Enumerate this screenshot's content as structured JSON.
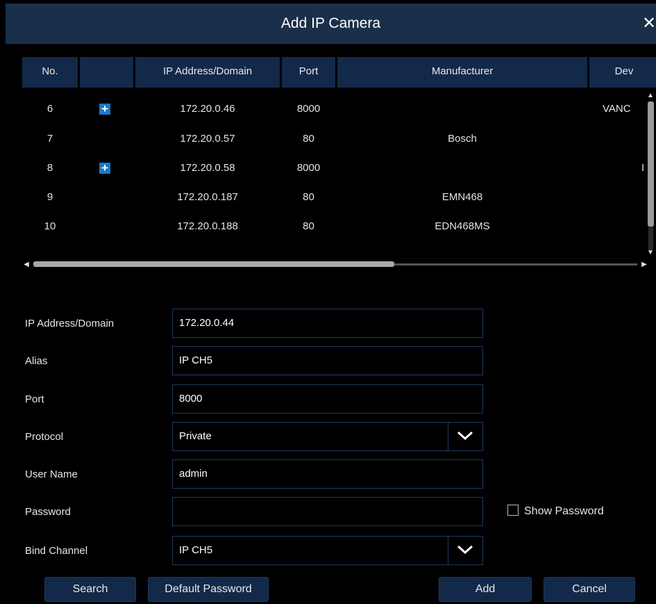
{
  "dialog": {
    "title": "Add IP Camera",
    "close_glyph": "✕"
  },
  "table": {
    "headers": [
      "No.",
      "",
      "IP Address/Domain",
      "Port",
      "Manufacturer",
      "Dev"
    ],
    "rows": [
      {
        "no": "6",
        "plus": true,
        "ip": "172.20.0.46",
        "port": "8000",
        "manufacturer": "",
        "device": "VANC"
      },
      {
        "no": "7",
        "plus": false,
        "ip": "172.20.0.57",
        "port": "80",
        "manufacturer": "Bosch",
        "device": ""
      },
      {
        "no": "8",
        "plus": true,
        "ip": "172.20.0.58",
        "port": "8000",
        "manufacturer": "",
        "device": "I"
      },
      {
        "no": "9",
        "plus": false,
        "ip": "172.20.0.187",
        "port": "80",
        "manufacturer": "EMN468",
        "device": ""
      },
      {
        "no": "10",
        "plus": false,
        "ip": "172.20.0.188",
        "port": "80",
        "manufacturer": "EDN468MS",
        "device": ""
      }
    ]
  },
  "form": {
    "ip_label": "IP Address/Domain",
    "ip_value": "172.20.0.44",
    "alias_label": "Alias",
    "alias_value": "IP CH5",
    "port_label": "Port",
    "port_value": "8000",
    "protocol_label": "Protocol",
    "protocol_value": "Private",
    "username_label": "User Name",
    "username_value": "admin",
    "password_label": "Password",
    "password_value": "",
    "show_password_label": "Show Password",
    "bind_label": "Bind Channel",
    "bind_value": "IP CH5"
  },
  "buttons": {
    "search": "Search",
    "default_password": "Default Password",
    "add": "Add",
    "cancel": "Cancel"
  },
  "colors": {
    "header_bg": "#13294a",
    "titlebar_bg": "#1a2f4a",
    "accent": "#1a78c8"
  }
}
